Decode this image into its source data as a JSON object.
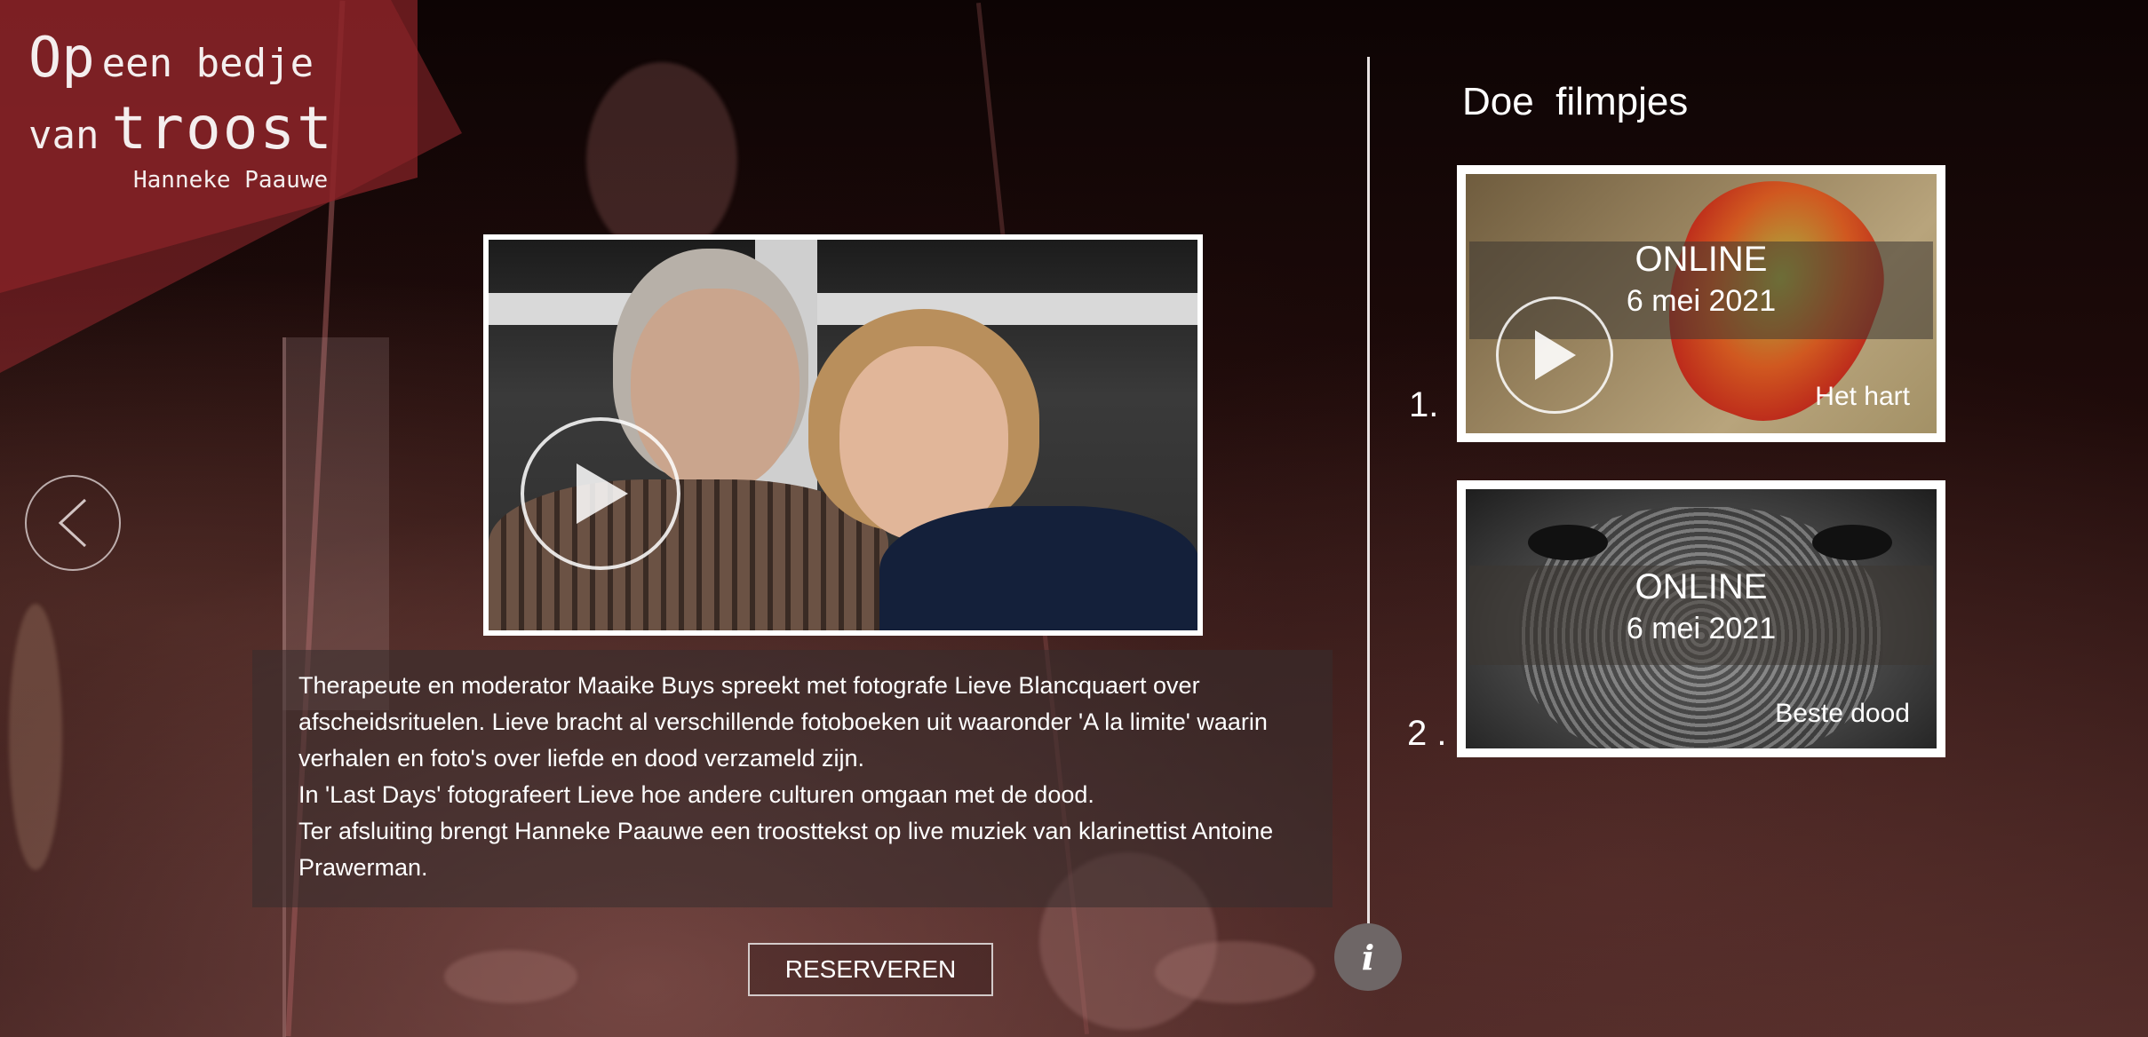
{
  "logo": {
    "line1_big": "Op",
    "line1_small": "een bedje",
    "line2_small": "van",
    "line2_big": "troost",
    "author": "Hanneke Paauwe"
  },
  "navigation": {
    "prev_icon": "chevron-left-icon"
  },
  "main": {
    "video_play_icon": "play-icon",
    "description": [
      "Therapeute en moderator Maaike Buys spreekt met fotografe Lieve Blancquaert over afscheidsrituelen. Lieve bracht al verschillende fotoboeken uit waaronder 'A la limite' waarin verhalen en foto's over liefde en dood verzameld zijn.",
      "In 'Last Days' fotografeert Lieve hoe andere culturen omgaan met de dood.",
      "Ter afsluiting brengt Hanneke Paauwe een troosttekst op live muziek van klarinettist Antoine Prawerman."
    ],
    "reserve_label": "RESERVEREN"
  },
  "info_button": {
    "label": "i"
  },
  "sidebar": {
    "title": "Doe  filmpjes",
    "items": [
      {
        "number": "1.",
        "status": "ONLINE",
        "date": "6 mei 2021",
        "caption": "Het hart"
      },
      {
        "number": "2 .",
        "status": "ONLINE",
        "date": "6 mei 2021",
        "caption": "Beste dood"
      }
    ]
  },
  "colors": {
    "background": "#1f0b0a",
    "logo_red": "#96282d",
    "frame": "#ffffff",
    "info_button": "#6e6666"
  }
}
